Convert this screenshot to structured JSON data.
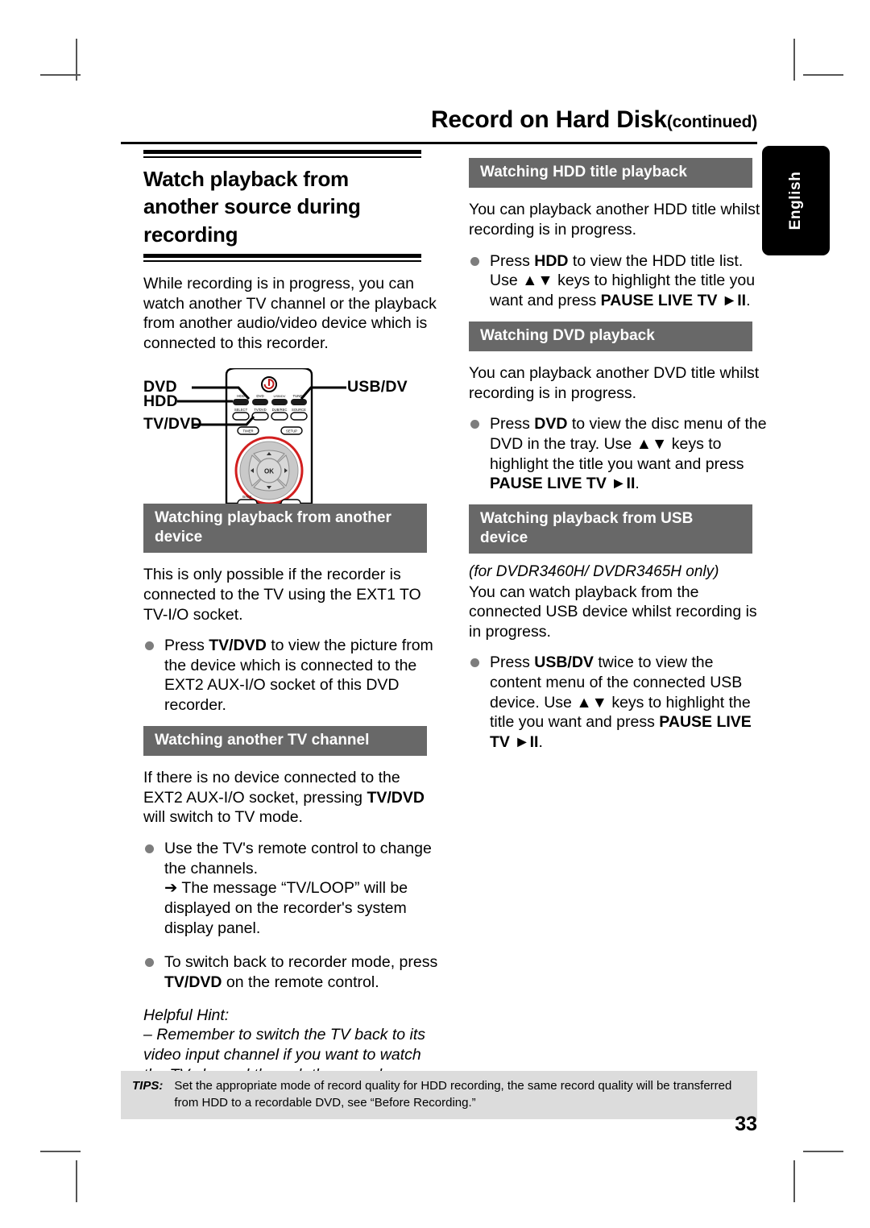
{
  "header": {
    "chapter_title": "Record on Hard Disk",
    "chapter_continued": "(continued)"
  },
  "language_tab": {
    "label": "English"
  },
  "left_column": {
    "section_heading": "Watch playback from another source during recording",
    "intro": "While recording is in progress, you can watch another TV channel or the playback from another audio/video device which is connected to this recorder.",
    "remote_labels": {
      "dvd": "DVD",
      "hdd": "HDD",
      "tv_dvd": "TV/DVD",
      "usb_dv": "USB/DV"
    },
    "sub1": {
      "bar": "Watching playback from another device",
      "body": "This is only possible if the recorder is connected to the TV using the EXT1 TO TV-I/O socket.",
      "bullet1_a": "Press ",
      "bullet1_b": "TV/DVD",
      "bullet1_c": " to view the picture from the device which is connected to the EXT2 AUX-I/O socket of this DVD recorder."
    },
    "sub2": {
      "bar": "Watching another TV channel",
      "body_a": "If there is no device connected to the EXT2 AUX-I/O socket, pressing ",
      "body_b": "TV/DVD",
      "body_c": " will switch to TV mode.",
      "bullet1": "Use the TV's remote control to change the channels.",
      "bullet1_arrow": "➔ The message “TV/LOOP” will be displayed on the recorder's system display panel.",
      "bullet2_a": "To switch back to recorder mode, press ",
      "bullet2_b": "TV/DVD",
      "bullet2_c": " on the remote control."
    },
    "hint": {
      "title": "Helpful Hint:",
      "text": "– Remember to switch the TV back to its video input channel if you want to watch the TV channel through the recorder or playback the recorded disc."
    }
  },
  "right_column": {
    "sub1": {
      "bar": "Watching HDD title playback",
      "body": "You can playback another HDD title whilst recording is in progress.",
      "bullet_a": "Press ",
      "bullet_b": "HDD",
      "bullet_c": " to view the HDD title list. Use ",
      "bullet_keys": "▲▼",
      "bullet_d": " keys to highlight the title you want and press ",
      "bullet_e": "PAUSE LIVE TV ",
      "bullet_playpause": "►II",
      "bullet_f": "."
    },
    "sub2": {
      "bar": "Watching DVD playback",
      "body": "You can playback another DVD title whilst recording is in progress.",
      "bullet_a": "Press ",
      "bullet_b": "DVD",
      "bullet_c": " to view the disc menu of the DVD in the tray. Use ",
      "bullet_keys": "▲▼",
      "bullet_d": " keys to highlight the title you want and press ",
      "bullet_e": "PAUSE LIVE TV ",
      "bullet_playpause": "►II",
      "bullet_f": "."
    },
    "sub3": {
      "bar": "Watching playback from USB device",
      "models": "(for DVDR3460H/ DVDR3465H only)",
      "body": "You can watch playback from the connected USB device whilst recording is in progress.",
      "bullet_a": "Press ",
      "bullet_b": "USB/DV",
      "bullet_c": " twice to view the content menu of the connected USB device. Use ",
      "bullet_keys": "▲▼",
      "bullet_d": " keys to highlight the title you want and press ",
      "bullet_e": "PAUSE LIVE TV ",
      "bullet_playpause": "►II",
      "bullet_f": "."
    }
  },
  "tips": {
    "label": "TIPS:",
    "text": "Set the appropriate mode of record quality for HDD recording, the same record quality will be transferred from HDD to a recordable DVD, see “Before Recording.”"
  },
  "page_number": "33"
}
